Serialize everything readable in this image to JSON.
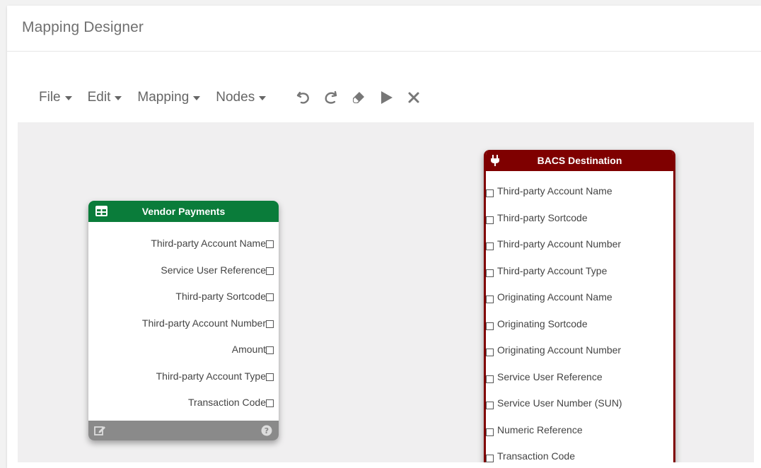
{
  "window": {
    "title": "Mapping Designer"
  },
  "toolbar": {
    "menus": [
      "File",
      "Edit",
      "Mapping",
      "Nodes"
    ],
    "tools": [
      "undo-icon",
      "redo-icon",
      "eraser-icon",
      "play-icon",
      "close-icon"
    ]
  },
  "nodes": {
    "vendor": {
      "title": "Vendor Payments",
      "header_color": "#0a7c3a",
      "header_icon": "table-icon",
      "fields": [
        "Third-party Account Name",
        "Service User Reference",
        "Third-party Sortcode",
        "Third-party Account Number",
        "Amount",
        "Third-party Account Type",
        "Transaction Code"
      ],
      "footer_icons": [
        "edit-icon",
        "help-icon"
      ]
    },
    "bacs": {
      "title": "BACS Destination",
      "header_color": "#7f0000",
      "header_icon": "plug-icon",
      "fields": [
        "Third-party Account Name",
        "Third-party Sortcode",
        "Third-party Account Number",
        "Third-party Account Type",
        "Originating Account Name",
        "Originating Sortcode",
        "Originating Account Number",
        "Service User Reference",
        "Service User Number (SUN)",
        "Numeric Reference",
        "Transaction Code"
      ]
    }
  }
}
